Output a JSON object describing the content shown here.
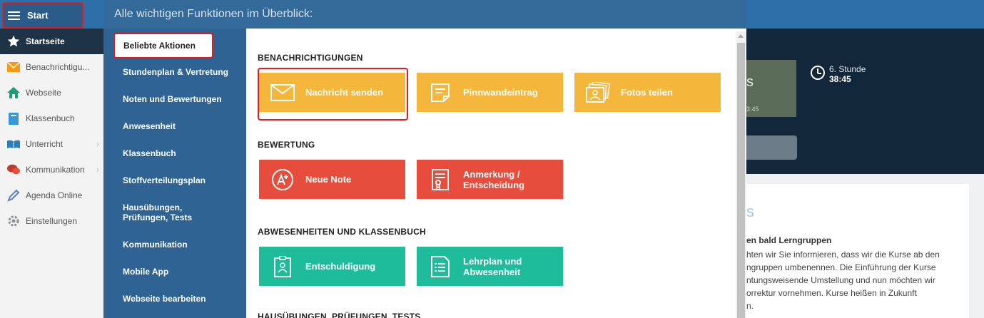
{
  "topbar": {
    "start_label": "Start"
  },
  "sidebar": {
    "items": [
      {
        "label": "Startseite",
        "icon": "star-icon"
      },
      {
        "label": "Benachrichtigu...",
        "icon": "envelope-icon"
      },
      {
        "label": "Webseite",
        "icon": "home-icon"
      },
      {
        "label": "Klassenbuch",
        "icon": "book-icon"
      },
      {
        "label": "Unterricht",
        "icon": "open-book-icon"
      },
      {
        "label": "Kommunikation",
        "icon": "chat-icon"
      },
      {
        "label": "Agenda Online",
        "icon": "pen-icon"
      },
      {
        "label": "Einstellungen",
        "icon": "gear-icon"
      }
    ]
  },
  "overlay": {
    "header": "Alle wichtigen Funktionen im Überblick:",
    "nav": [
      "Beliebte Aktionen",
      "Stundenplan & Vertretung",
      "Noten und Bewertungen",
      "Anwesenheit",
      "Klassenbuch",
      "Stoffverteilungsplan",
      "Hausübungen, Prüfungen, Tests",
      "Kommunikation",
      "Mobile App",
      "Webseite bearbeiten"
    ],
    "sections": [
      {
        "title": "BENACHRICHTIGUNGEN"
      },
      {
        "title": "BEWERTUNG"
      },
      {
        "title": "ABWESENHEITEN UND KLASSENBUCH"
      },
      {
        "title": "HAUSÜBUNGEN, PRÜFUNGEN, TESTS"
      }
    ],
    "tiles": {
      "nachricht": "Nachricht senden",
      "pinnwand": "Pinnwandeintrag",
      "fotos": "Fotos teilen",
      "note": "Neue Note",
      "anmerkung": "Anmerkung / Entscheidung",
      "entschuldigung": "Entschuldigung",
      "lehrplan": "Lehrplan und Abwesenheit"
    }
  },
  "background": {
    "card_letter": "s",
    "card_time": "3:45",
    "clock_label": "6. Stunde",
    "clock_value": "38:45",
    "news_letter": "s",
    "news_title": "en bald Lerngruppen",
    "news_lines": [
      "hten wir Sie informieren, dass wir die Kurse ab den",
      "ngruppen umbenennen. Die Einführung der Kurse",
      "ntungsweisende Umstellung und nun möchten wir",
      "orrektur vornehmen. Kurse heißen in Zukunft",
      "n."
    ]
  },
  "colors": {
    "topbar": "#2d6fa8",
    "nav": "#2e6394",
    "tile_yellow": "#f4b73c",
    "tile_red": "#e74d3d",
    "tile_green": "#1fbc9b",
    "highlight": "#e11d1d"
  }
}
